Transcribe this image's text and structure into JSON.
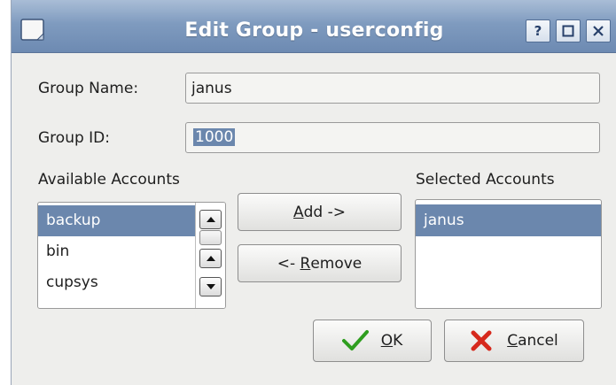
{
  "window": {
    "title": "Edit Group - userconfig",
    "help_label": "?"
  },
  "form": {
    "group_name_label": "Group Name:",
    "group_name_value": "janus",
    "group_id_label": "Group ID:",
    "group_id_value": "1000"
  },
  "available": {
    "label": "Available Accounts",
    "items": [
      "backup",
      "bin",
      "cupsys"
    ],
    "selected": "backup"
  },
  "selected": {
    "label": "Selected Accounts",
    "items": [
      "janus"
    ]
  },
  "buttons": {
    "add_mnemonic": "A",
    "add_rest": "dd ->",
    "remove_prefix": "<- ",
    "remove_mnemonic": "R",
    "remove_rest": "emove",
    "ok_mnemonic": "O",
    "ok_rest": "K",
    "cancel_mnemonic": "C",
    "cancel_rest": "ancel"
  },
  "colors": {
    "titlebar": "#7f9bbf",
    "selection": "#6b87ad",
    "ok_check": "#2f9e1f",
    "cancel_x": "#d6281c"
  },
  "icons": {
    "ok": "check-icon",
    "cancel": "x-icon"
  }
}
